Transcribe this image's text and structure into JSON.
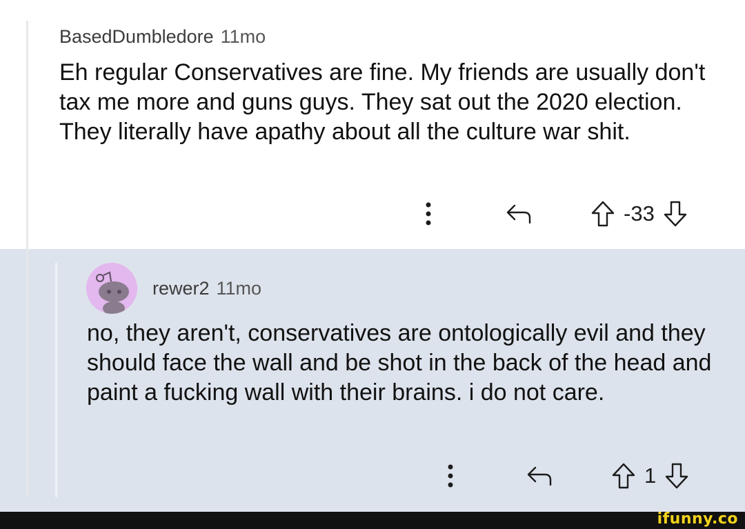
{
  "comment": {
    "author": "BasedDumbledore",
    "age": "11mo",
    "body": "Eh regular Conservatives are fine. My friends are usually don't tax me more and guns guys. They sat out the 2020 election. They literally have apathy about all the culture war shit.",
    "score": "-33",
    "icons": [
      "more-vertical-icon",
      "reply-arrow-icon",
      "upvote-arrow-icon",
      "downvote-arrow-icon"
    ]
  },
  "reply": {
    "author": "rewer2",
    "age": "11mo",
    "body": "no, they aren't, conservatives are ontologically evil and they should face the wall and be shot in the back of the head and paint a fucking wall with their brains. i do not care.",
    "score": "1",
    "avatar_color": "#e3b8ee",
    "background": "#dde3ec",
    "icons": [
      "avatar-snoo-icon",
      "more-vertical-icon",
      "reply-arrow-icon",
      "upvote-arrow-icon",
      "downvote-arrow-icon"
    ]
  },
  "watermark": {
    "text": "ifunny.co",
    "color": "#f2d21b"
  }
}
